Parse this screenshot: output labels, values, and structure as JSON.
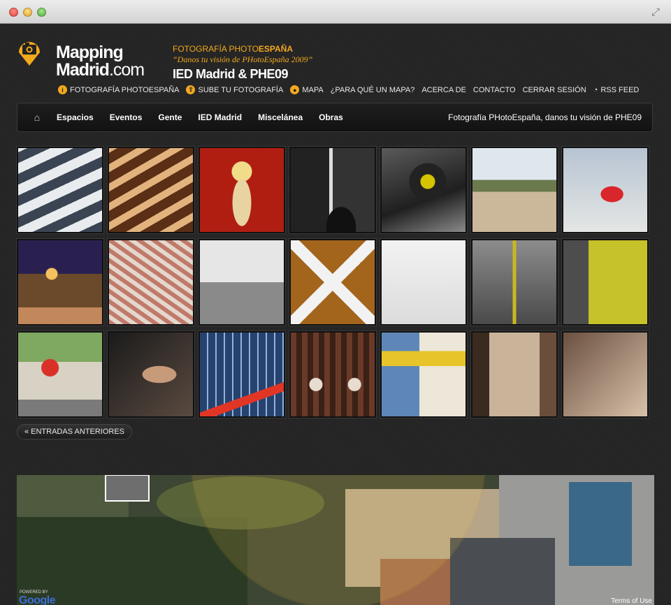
{
  "logo": {
    "line1": "Mapping",
    "line2_a": "Madrid",
    "line2_b": ".com"
  },
  "promo": {
    "line1_a": "FOTOGRAFÍA PHOTO",
    "line1_b": "ESPAÑA",
    "line2": "“Danos tu visión de PHotoEspaña 2009”",
    "line3": "IED Madrid & PHE09"
  },
  "topnav": [
    {
      "label": "FOTOGRAFÍA PHOTOESPAÑA",
      "icon": "info-icon"
    },
    {
      "label": "SUBE TU FOTOGRAFÍA",
      "icon": "upload-icon"
    },
    {
      "label": "MAPA",
      "icon": "map-pin-icon"
    },
    {
      "label": "¿PARA QUÉ UN MAPA?",
      "icon": ""
    },
    {
      "label": "ACERCA DE",
      "icon": ""
    },
    {
      "label": "CONTACTO",
      "icon": ""
    },
    {
      "label": "CERRAR SESIÓN",
      "icon": ""
    },
    {
      "label": "RSS FEED",
      "icon": "rss-icon"
    }
  ],
  "menu": {
    "items": [
      "Espacios",
      "Eventos",
      "Gente",
      "IED Madrid",
      "Miscelánea",
      "Obras"
    ],
    "tagline": "Fotografía PHotoEspaña, danos tu visión de PHE09"
  },
  "thumbnails_count": 21,
  "pagination": {
    "previous": "« ENTRADAS ANTERIORES"
  },
  "map": {
    "powered_by": "POWERED BY",
    "google": "Google",
    "terms": "Terms of Use"
  },
  "colors": {
    "accent": "#f2a91c",
    "background": "#262626"
  }
}
